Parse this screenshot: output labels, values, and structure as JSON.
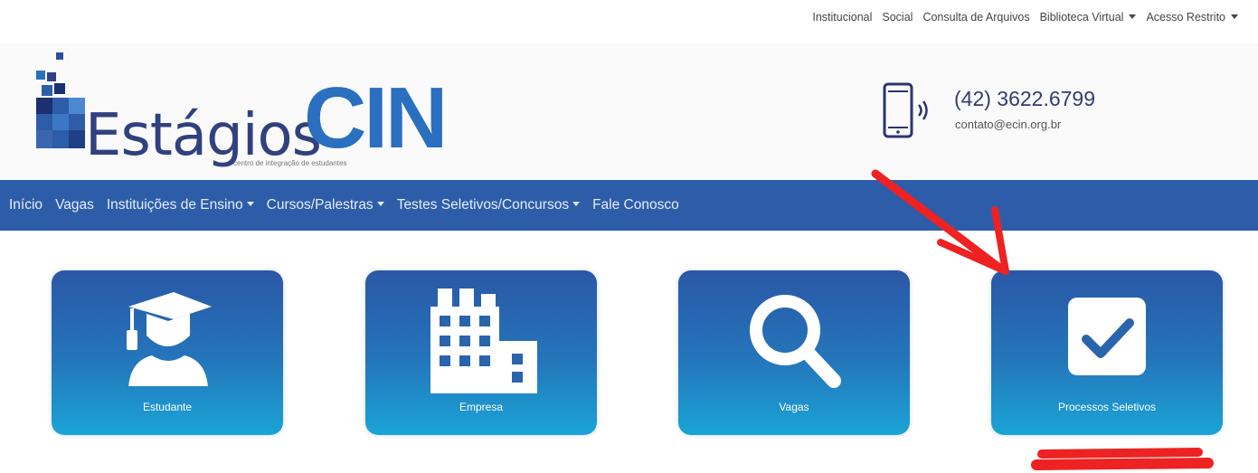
{
  "topbar": {
    "items": [
      {
        "label": "Institucional",
        "dropdown": false
      },
      {
        "label": "Social",
        "dropdown": false
      },
      {
        "label": "Consulta de Arquivos",
        "dropdown": false
      },
      {
        "label": "Biblioteca Virtual",
        "dropdown": true
      },
      {
        "label": "Acesso Restrito",
        "dropdown": true
      }
    ]
  },
  "logo": {
    "word": "Estágios",
    "brand": "CIN",
    "tagline": "centro de integração de estudantes"
  },
  "contact": {
    "phone": "(42) 3622.6799",
    "email": "contato@ecin.org.br"
  },
  "nav": {
    "items": [
      {
        "label": "Início",
        "dropdown": false
      },
      {
        "label": "Vagas",
        "dropdown": false
      },
      {
        "label": "Instituições de Ensino",
        "dropdown": true
      },
      {
        "label": "Cursos/Palestras",
        "dropdown": true
      },
      {
        "label": "Testes Seletivos/Concursos",
        "dropdown": true
      },
      {
        "label": "Fale Conosco",
        "dropdown": false
      }
    ]
  },
  "tiles": [
    {
      "label": "Estudante",
      "icon": "graduate-icon"
    },
    {
      "label": "Empresa",
      "icon": "building-icon"
    },
    {
      "label": "Vagas",
      "icon": "search-icon"
    },
    {
      "label": "Processos Seletivos",
      "icon": "checkbox-icon"
    }
  ],
  "colors": {
    "nav": "#2d5da8",
    "tile_top": "#2a57a6",
    "tile_bottom": "#1aa4d6",
    "annotation": "#ee2222",
    "brand_dark": "#31417f",
    "brand_blue": "#2a6fc0"
  }
}
